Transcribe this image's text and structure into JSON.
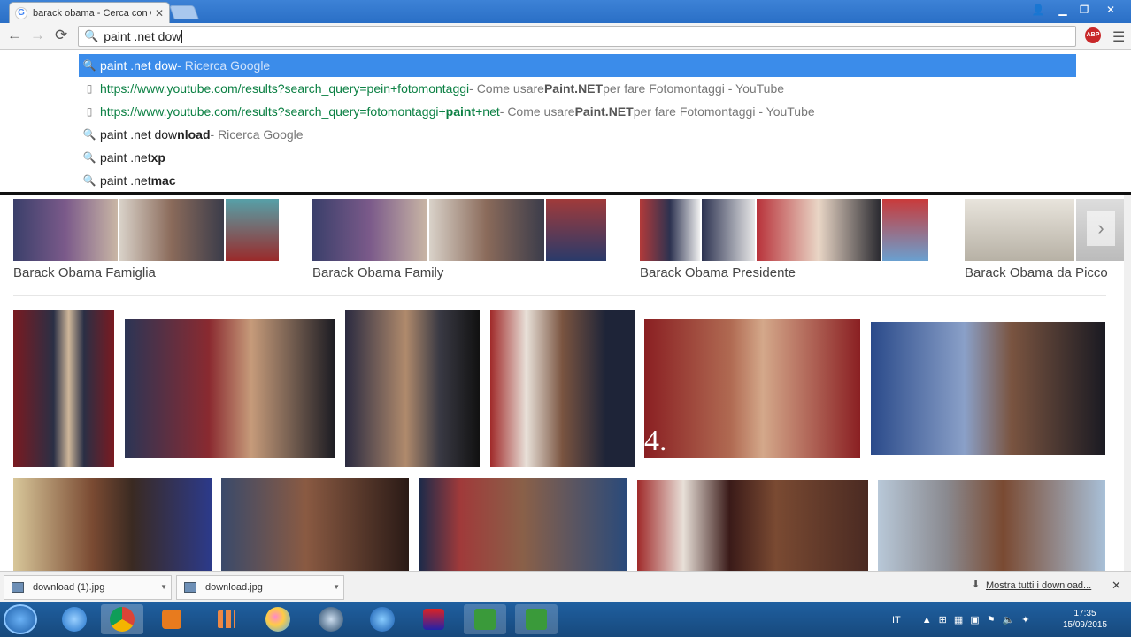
{
  "window": {
    "tab_title": "barack obama - Cerca con Google",
    "tab_favicon": "G"
  },
  "toolbar": {
    "omnibox_value": "paint .net dow"
  },
  "dropdown": {
    "suggestions": [
      {
        "icon": "search-icon",
        "pre": "paint .net dow",
        "bold": "",
        "url": "",
        "desc": " - Ricerca Google",
        "selected": true
      },
      {
        "icon": "page-icon",
        "pre": "",
        "bold": "",
        "url": "https://www.youtube.com/results?search_query=pein+fotomontaggi",
        "desc_pre": " - Come usare ",
        "desc_bold": "Paint.NET",
        "desc_post": " per fare Fotomontaggi - YouTube"
      },
      {
        "icon": "page-icon",
        "pre": "",
        "bold": "",
        "url_pre": "https://www.youtube.com/results?search_query=fotomontaggi+",
        "url_bold": "paint",
        "url_post": "+net",
        "desc_pre": " - Come usare ",
        "desc_bold": "Paint.NET",
        "desc_post": " per fare Fotomontaggi - YouTube"
      },
      {
        "icon": "search-icon",
        "pre": "paint .net dow",
        "bold": "nload",
        "desc": " - Ricerca Google"
      },
      {
        "icon": "search-icon",
        "pre": "paint .net ",
        "bold": "xp",
        "desc": ""
      },
      {
        "icon": "search-icon",
        "pre": "paint .net ",
        "bold": "mac",
        "desc": ""
      }
    ]
  },
  "related": [
    {
      "label": "Barack Obama Famiglia"
    },
    {
      "label": "Barack Obama Family"
    },
    {
      "label": "Barack Obama Presidente"
    },
    {
      "label": "Barack Obama da Picco"
    }
  ],
  "overlay_text": "4.",
  "downloads": [
    {
      "name": "download (1).jpg"
    },
    {
      "name": "download.jpg"
    }
  ],
  "download_bar": {
    "show_all": "Mostra tutti i download..."
  },
  "taskbar": {
    "lang": "IT",
    "time": "17:35",
    "date": "15/09/2015"
  },
  "colors": {
    "selected_suggestion": "#3b8cea",
    "url_green": "#0b8043",
    "taskbar": "#1f5fa0"
  }
}
